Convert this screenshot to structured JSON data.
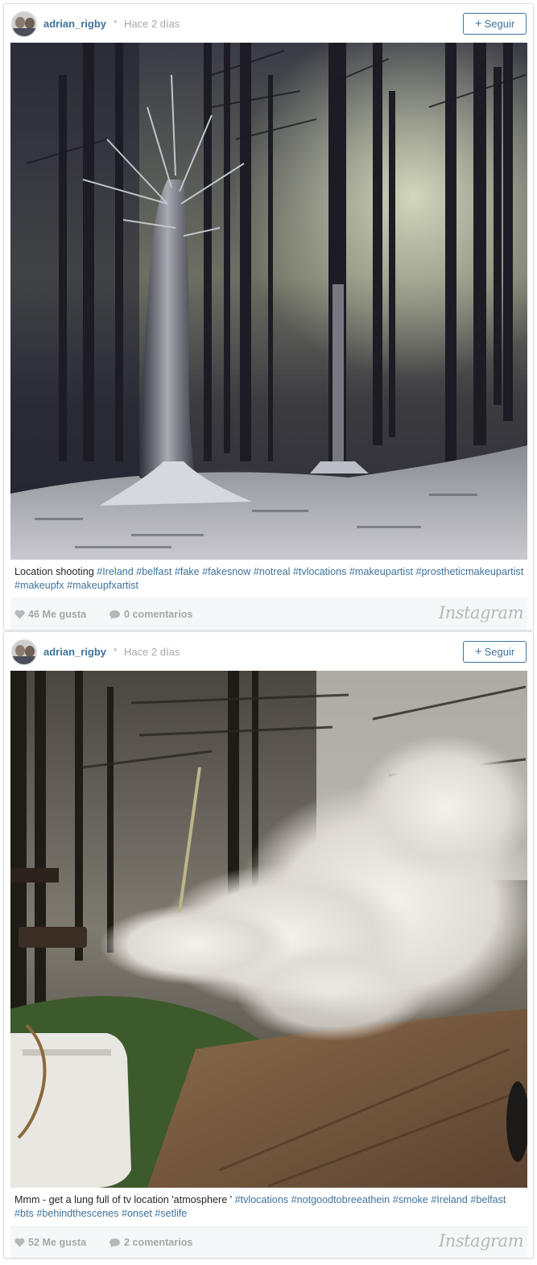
{
  "colors": {
    "link": "#3f729b",
    "muted": "#a5a7aa",
    "footer_bg": "#f6f7f9"
  },
  "posts": [
    {
      "username": "adrian_rigby",
      "separator": "•",
      "time": "Hace 2 días",
      "follow_label": "Seguir",
      "follow_icon": "plus-icon",
      "caption_text": "Location shooting ",
      "hashtags": [
        "#Ireland",
        "#belfast",
        "#fake",
        "#fakesnow",
        "#notreal",
        "#tvlocations",
        "#makeupartist",
        "#prostheticmakeupartist",
        "#makeupfx",
        "#makeupfxartist"
      ],
      "likes": "46 Me gusta",
      "comments": "0 comentarios",
      "brand": "Instagram",
      "photo_subject": "snowy-forest-photo"
    },
    {
      "username": "adrian_rigby",
      "separator": "•",
      "time": "Hace 2 días",
      "follow_label": "Seguir",
      "follow_icon": "plus-icon",
      "caption_text": "Mmm - get a lung full of tv location 'atmosphere ' ",
      "hashtags": [
        "#tvlocations",
        "#notgoodtobreeathein",
        "#smoke",
        "#Ireland",
        "#belfast",
        "#bts",
        "#behindthescenes",
        "#onset",
        "#setlife"
      ],
      "likes": "52 Me gusta",
      "comments": "2 comentarios",
      "brand": "Instagram",
      "photo_subject": "smoke-machine-forest-photo"
    }
  ]
}
